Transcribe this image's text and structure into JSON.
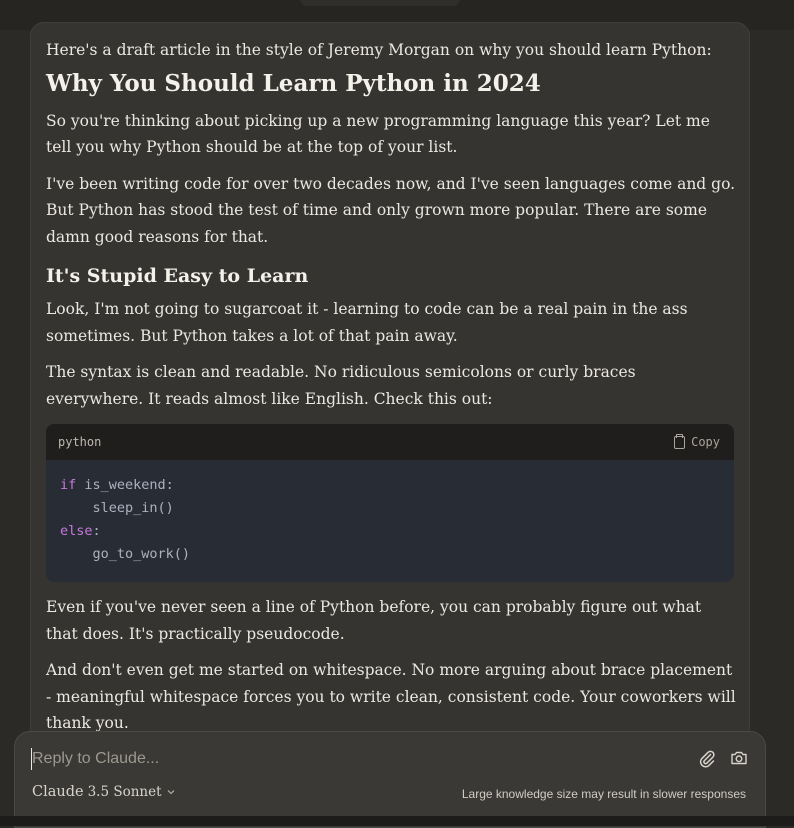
{
  "article": {
    "intro": "Here's a draft article in the style of Jeremy Morgan on why you should learn Python:",
    "title": "Why You Should Learn Python in 2024",
    "para1": "So you're thinking about picking up a new programming language this year? Let me tell you why Python should be at the top of your list.",
    "para2": "I've been writing code for over two decades now, and I've seen languages come and go. But Python has stood the test of time and only grown more popular. There are some damn good reasons for that.",
    "heading2": "It's Stupid Easy to Learn",
    "para3": "Look, I'm not going to sugarcoat it - learning to code can be a real pain in the ass sometimes. But Python takes a lot of that pain away.",
    "para4": "The syntax is clean and readable. No ridiculous semicolons or curly braces everywhere. It reads almost like English. Check this out:",
    "para5": "Even if you've never seen a line of Python before, you can probably figure out what that does. It's practically pseudocode.",
    "para6": "And don't even get me started on whitespace. No more arguing about brace placement - meaningful whitespace forces you to write clean, consistent code. Your coworkers will thank you."
  },
  "code_block": {
    "language": "python",
    "copy_label": "Copy",
    "lines": [
      {
        "kw": "if",
        "rest": " is_weekend:"
      },
      {
        "kw": "",
        "rest": "    sleep_in()"
      },
      {
        "kw": "else",
        "rest": ":"
      },
      {
        "kw": "",
        "rest": "    go_to_work()"
      }
    ]
  },
  "composer": {
    "placeholder": "Reply to Claude...",
    "model_name": "Claude",
    "model_version": "3.5 Sonnet",
    "notice": "Large knowledge size may result in slower responses",
    "icons": [
      "paperclip-icon",
      "camera-icon",
      "chevron-down-icon",
      "copy-icon"
    ]
  },
  "colors": {
    "background": "#2b2a27",
    "message_bg": "#353431",
    "code_bg": "#282c34",
    "keyword": "#c678dd"
  }
}
